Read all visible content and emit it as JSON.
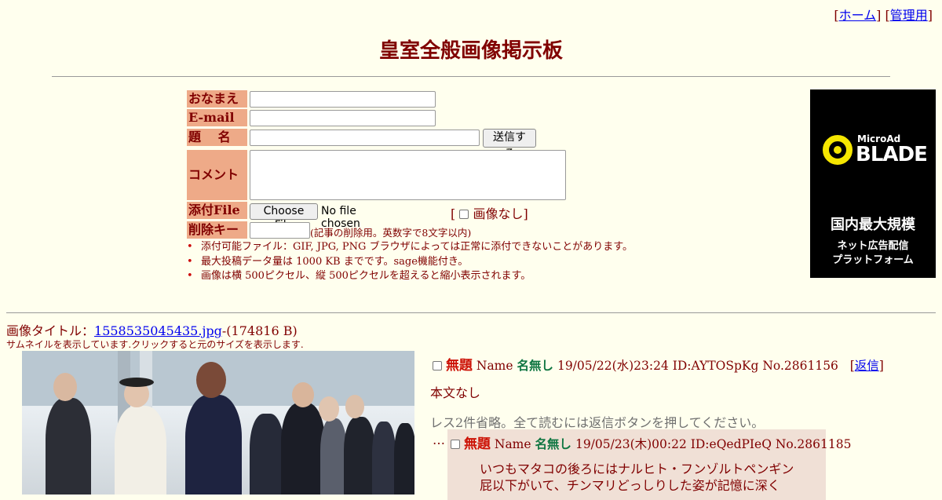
{
  "header": {
    "links": [
      {
        "label": "ホーム"
      },
      {
        "label": "管理用"
      }
    ],
    "title": "皇室全般画像掲示板"
  },
  "form": {
    "name_label": "おなまえ",
    "email_label": "E-mail",
    "subject_label": "題　 名",
    "submit_label": "送信する",
    "comment_label": "コメント",
    "file_label": "添付File",
    "choose_file_label": "Choose File",
    "no_file_text": "No file chosen",
    "no_image_label": "画像なし",
    "delkey_label": "削除キー",
    "delkey_note": "(記事の削除用。英数字で8文字以内)",
    "notes": [
      "添付可能ファイル：GIF, JPG, PNG ブラウザによっては正常に添付できないことがあります。",
      "最大投稿データ量は 1000 KB までです。sage機能付き。",
      "画像は横 500ピクセル、縦 500ピクセルを超えると縮小表示されます。"
    ]
  },
  "ad": {
    "brand_small": "MicroAd",
    "brand_big": "BLADE",
    "headline": "国内最大規模",
    "sub1": "ネット広告配信",
    "sub2": "プラットフォーム"
  },
  "thread": {
    "image_title_label": "画像タイトル：",
    "image_file": "1558535045435.jpg",
    "image_size": "-(174816 B)",
    "thumb_note": "サムネイルを表示しています.クリックすると元のサイズを表示します.",
    "op": {
      "subject": "無題",
      "name_label": "Name",
      "name": "名無し",
      "date": "19/05/22(水)23:24 ID:AYTOSpKg No.2861156",
      "reply_link": "返信",
      "body": "本文なし"
    },
    "omitted": "レス2件省略。全て読むには返信ボタンを押してください。",
    "reply_marker": "…",
    "reply": {
      "subject": "無題",
      "name_label": "Name",
      "name": "名無し",
      "date": "19/05/23(木)00:22 ID:eQedPIeQ No.2861185",
      "body_line1": "いつもマタコの後ろにはナルヒト・フンゾルトペンギン",
      "body_line2": "屁以下がいて、チンマリどっしりした姿が記憶に深く"
    }
  },
  "colors": {
    "background": "#ffffee",
    "text": "#800000",
    "label_bg": "#eeaa88",
    "subject": "#cc1105",
    "name": "#117743",
    "reply_bg": "#f0e0d6"
  }
}
